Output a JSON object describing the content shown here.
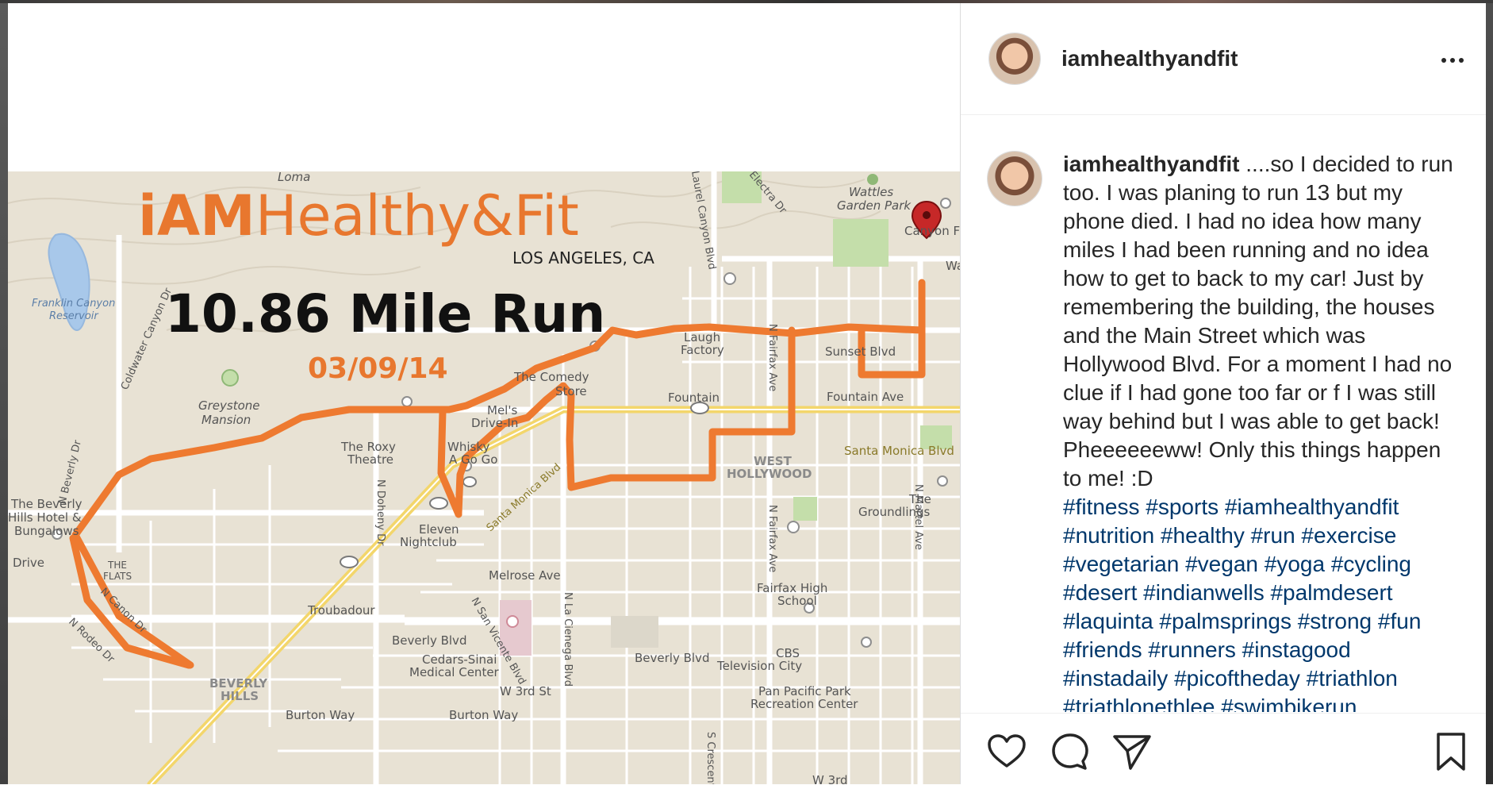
{
  "post": {
    "username": "iamhealthyandfit",
    "caption_text": " ....so I decided to run too. I was planing to run 13 but my phone died. I had no idea how many miles I had been running and no idea how to get to back to my car! Just by remembering the building, the houses and the Main Street which was Hollywood Blvd. For a moment I had no clue if I had gone too far or f I was still way behind but I was able to get back! Pheeeeeeww! Only this things happen to me! :D",
    "hashtags": "#fitness #sports #iamhealthyandfit #nutrition #healthy #run #exercise #vegetarian #vegan #yoga #cycling #desert #indianwells #palmdesert #laquinta #palmsprings #strong #fun #friends #runners #instagood #instadaily #picoftheday #triathlon #triathlonethlee #swimbikerun"
  },
  "image": {
    "brand_prefix": "iAM",
    "brand_main": "Healthy&Fit",
    "location": "LOS ANGELES, CA",
    "headline": "10.86 Mile Run",
    "date": "03/09/14"
  },
  "map_labels": {
    "wattles": "Wattles",
    "garden_park": "Garden Park",
    "franklin1": "Franklin Canyon",
    "franklin2": "Reservoir",
    "greystone1": "Greystone",
    "greystone2": "Mansion",
    "beverly_hotel1": "The Beverly",
    "beverly_hotel2": "Hills Hotel &",
    "beverly_hotel3": "Bungalows",
    "drive": "Drive",
    "the_flats1": "THE",
    "the_flats2": "FLATS",
    "troubadour": "Troubadour",
    "roxy1": "The Roxy",
    "roxy2": "Theatre",
    "whisky1": "Whisky",
    "whisky2": "A Go Go",
    "comedy1": "The Comedy",
    "comedy2": "Store",
    "mels1": "Mel's",
    "mels2": "Drive-In",
    "laugh1": "Laugh",
    "laugh2": "Factory",
    "eleven1": "Eleven",
    "eleven2": "Nightclub",
    "fountain": "Fountain",
    "fountain_ave": "Fountain Ave",
    "sunset": "Sunset Blvd",
    "santa_monica": "Santa Monica Blvd",
    "santa_monica_diag": "Santa Monica Blvd",
    "west_hollywood1": "WEST",
    "west_hollywood2": "HOLLYWOOD",
    "groundlings1": "The",
    "groundlings2": "Groundlings",
    "fairfax_high1": "Fairfax High",
    "fairfax_high2": "School",
    "melrose": "Melrose Ave",
    "beverly_blvd1": "Beverly Blvd",
    "beverly_blvd2": "Beverly Blvd",
    "cedars1": "Cedars-Sinai",
    "cedars2": "Medical Center",
    "cbs1": "CBS",
    "cbs2": "Television City",
    "pan_pacific1": "Pan Pacific Park",
    "pan_pacific2": "Recreation Center",
    "w3rd": "W 3rd St",
    "w3rd2": "W 3rd",
    "burton1": "Burton Way",
    "burton2": "Burton Way",
    "beverly_hills1": "BEVERLY",
    "beverly_hills2": "HILLS",
    "n_fairfax_1": "N Fairfax Ave",
    "n_fairfax_2": "N Fairfax Ave",
    "n_la_cienega": "N La Cienega Blvd",
    "n_san_vicente": "N San Vicente Blvd",
    "n_doheny": "N Doheny Dr",
    "n_canon": "N Canon Dr",
    "n_rodeo": "N Rodeo Dr",
    "n_beverly": "N Beverly Dr",
    "coldwater": "Coldwater Canyon Dr",
    "laurel_canyon": "Laurel Canyon Blvd",
    "electra": "Electra Dr",
    "n_martel": "N Martel Ave",
    "loma": "Loma",
    "s_crescent": "S Crescent",
    "canyon_frag": "Canyon F",
    "wa_frag": "Wa"
  },
  "colors": {
    "route": "#ee7a30",
    "brand_orange": "#e8772e",
    "map_bg": "#e8e2d4",
    "park_green": "#c4deaa",
    "water": "#a8c8ea",
    "yellow_road": "#f3d66b",
    "hashtag": "#00376b"
  },
  "icons": {
    "more": "more-options-icon",
    "like": "heart-icon",
    "comment": "comment-icon",
    "share": "paper-plane-icon",
    "save": "bookmark-icon"
  }
}
